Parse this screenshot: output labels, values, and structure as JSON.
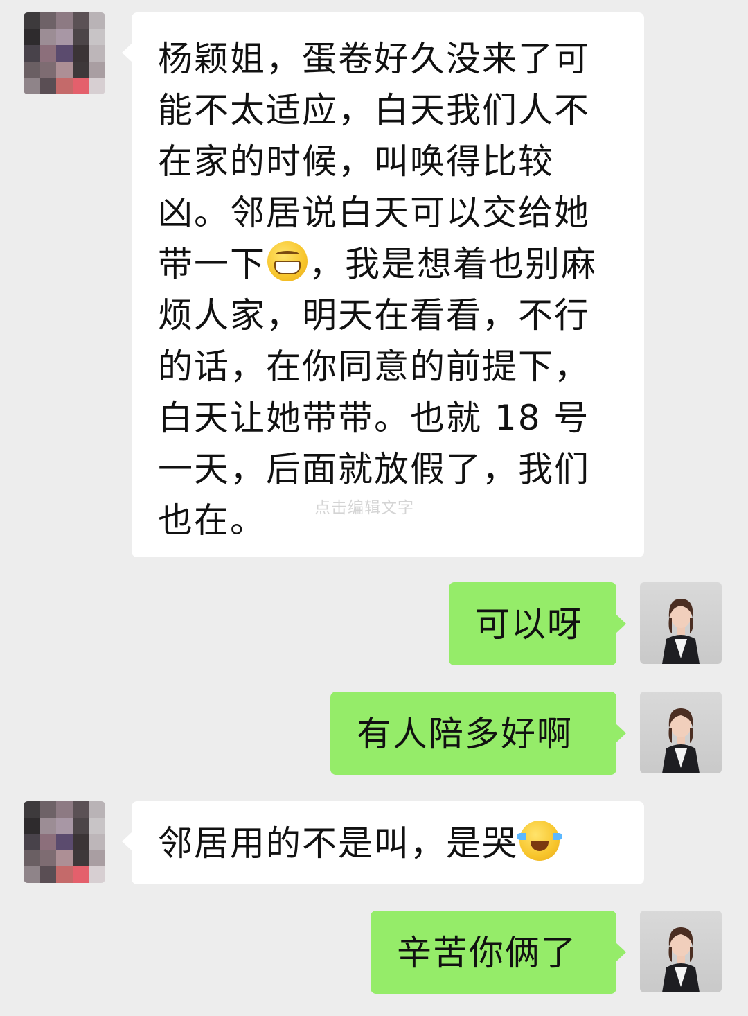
{
  "messages": [
    {
      "sender": "contact",
      "lines": [
        "杨颖姐，蛋卷好久没来了可",
        "能不太适应，白天我们人不",
        "在家的时候，叫唤得比较",
        "凶。邻居说白天可以交给她",
        "带一下",
        "，我是想着也别麻",
        "烦人家，明天在看看，不行",
        "的话，在你同意的前提下，",
        "白天让她带带。也就 18 号",
        "一天，后面就放假了，我们",
        "也在。"
      ],
      "emoji": "grinning-face",
      "overlay": "点击编辑文字"
    },
    {
      "sender": "me",
      "text": "可以呀"
    },
    {
      "sender": "me",
      "text": "有人陪多好啊"
    },
    {
      "sender": "contact",
      "text": "邻居用的不是叫，是哭",
      "emoji": "crying-laughing-face"
    },
    {
      "sender": "me",
      "text": "辛苦你俩了"
    }
  ],
  "colors": {
    "background": "#ededed",
    "incoming_bubble": "#ffffff",
    "outgoing_bubble": "#95ec69",
    "text": "#111111"
  }
}
